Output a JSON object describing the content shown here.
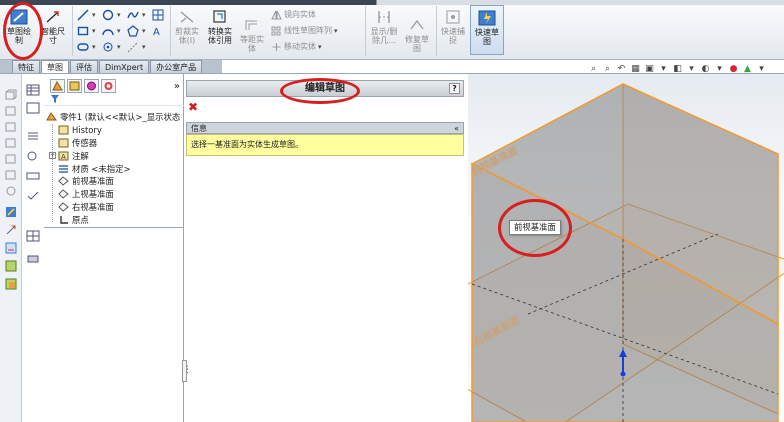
{
  "ribbon": {
    "sketch_label": "草图绘\n制",
    "smart_dimension_label": "智能尺\n寸",
    "trim_label": "剪裁实\n体(I)",
    "convert_label": "转换实\n体引用",
    "offset_label": "等距实\n体",
    "mirror_label": "镜向实体",
    "linear_pattern_label": "线性草图阵列",
    "move_label": "移动实体",
    "display_delete_label": "显示/删\n除几...",
    "repair_label": "修复草\n图",
    "quick_snap_label": "快速捕\n捉",
    "rapid_sketch_label": "快速草\n图"
  },
  "tabs": [
    {
      "label": "特征"
    },
    {
      "label": "草图"
    },
    {
      "label": "评估"
    },
    {
      "label": "DimXpert"
    },
    {
      "label": "办公室产品"
    }
  ],
  "tree": {
    "root": "零件1 (默认<<默认>_显示状态",
    "items": [
      {
        "label": "History",
        "icon": "history-icon"
      },
      {
        "label": "传感器",
        "icon": "sensor-icon"
      },
      {
        "label": "注解",
        "icon": "annotation-icon"
      },
      {
        "label": "材质 <未指定>",
        "icon": "material-icon"
      },
      {
        "label": "前视基准面",
        "icon": "plane-icon"
      },
      {
        "label": "上视基准面",
        "icon": "plane-icon"
      },
      {
        "label": "右视基准面",
        "icon": "plane-icon"
      },
      {
        "label": "原点",
        "icon": "origin-icon"
      }
    ]
  },
  "property_manager": {
    "title": "编辑草图",
    "help": "?",
    "info_title": "信息",
    "info_message": "选择一基准面为实体生成草图。"
  },
  "graphics": {
    "tooltip": "前视基准面",
    "plane_label_front": "前视基准面",
    "plane_label_right": "右视基准面"
  },
  "colors": {
    "accent_plane": "#f39a2e",
    "info_background": "#fefe9e",
    "annotation_red": "#d81e1e"
  }
}
